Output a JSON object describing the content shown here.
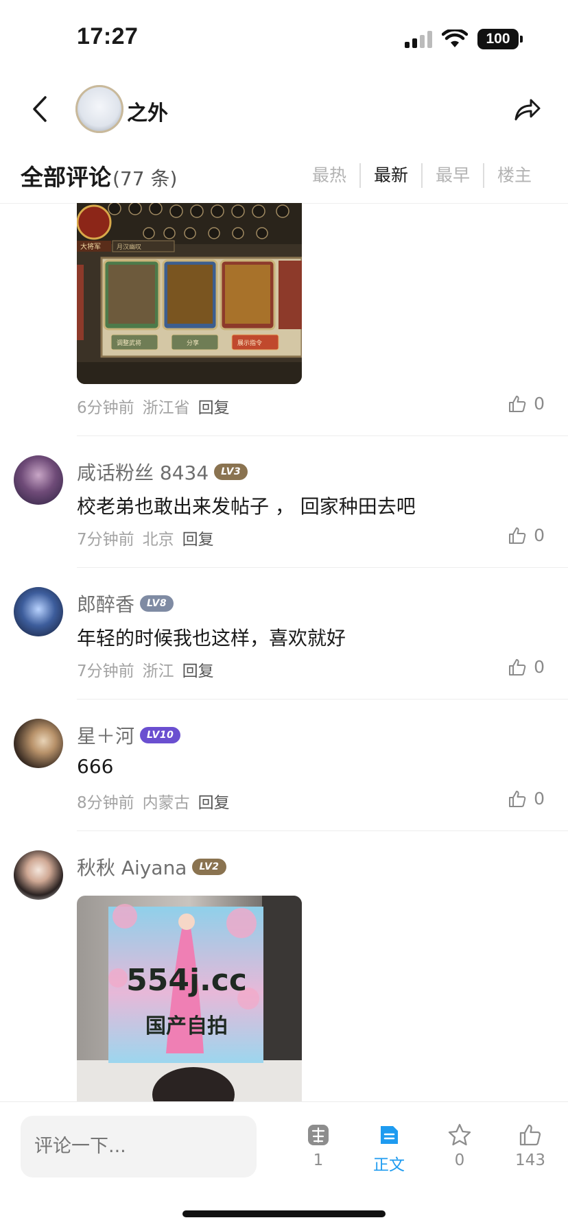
{
  "status_bar": {
    "time": "17:27",
    "battery": "100"
  },
  "header": {
    "title": "之外",
    "icons": [
      "back-icon",
      "share-icon"
    ]
  },
  "comments_section": {
    "title": "全部评论",
    "count": "(77 条)",
    "sort_tabs": [
      "最热",
      "最新",
      "最早",
      "楼主"
    ],
    "active_sort": "最新"
  },
  "comments": [
    {
      "time": "6分钟前",
      "location": "浙江省",
      "reply": "回复",
      "likes": "0",
      "image": "游戏截图",
      "image_labels": [
        "大将军",
        "月汉幽叹",
        "调整武将",
        "分享",
        "展示指令"
      ]
    },
    {
      "username": "咸话粉丝 8434",
      "level": "LV3",
      "level_color": "#8a7350",
      "text": "校老弟也敢出来发帖子 ， 回家种田去吧",
      "time": "7分钟前",
      "location": "北京",
      "reply": "回复",
      "likes": "0"
    },
    {
      "username": "郎醉香",
      "level": "LV8",
      "level_color": "#7f8ba3",
      "text": "年轻的时候我也这样，喜欢就好",
      "time": "7分钟前",
      "location": "浙江",
      "reply": "回复",
      "likes": "0"
    },
    {
      "username": "星＋河",
      "level": "LV10",
      "level_color": "#6a4fd0",
      "text": "666",
      "time": "8分钟前",
      "location": "内蒙古",
      "reply": "回复",
      "likes": "0"
    },
    {
      "username": "秋秋 Aiyana",
      "level": "LV2",
      "level_color": "#8a7350",
      "image_text": [
        "554j.cc",
        "国产自拍"
      ]
    }
  ],
  "bottom_bar": {
    "input_placeholder": "评论一下...",
    "actions": [
      {
        "icon": "recommend-icon",
        "label": "1"
      },
      {
        "icon": "article-icon",
        "label": "正文",
        "active": true
      },
      {
        "icon": "star-icon",
        "label": "0"
      },
      {
        "icon": "thumbs-up-icon",
        "label": "143"
      }
    ],
    "active_color": "#1e9bf0"
  }
}
